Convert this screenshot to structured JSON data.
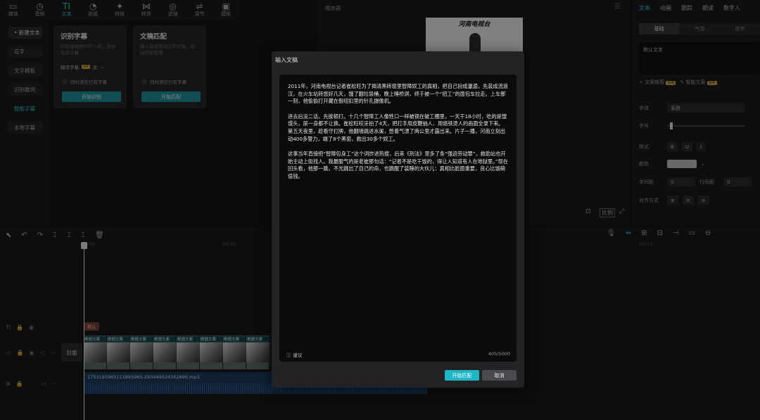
{
  "top_tabs": [
    {
      "label": "媒体",
      "icon": "media-icon",
      "glyph": "▭"
    },
    {
      "label": "音频",
      "icon": "audio-icon",
      "glyph": "◷"
    },
    {
      "label": "文本",
      "icon": "text-icon",
      "glyph": "TI"
    },
    {
      "label": "贴纸",
      "icon": "sticker-icon",
      "glyph": "◔"
    },
    {
      "label": "特效",
      "icon": "effects-icon",
      "glyph": "✦"
    },
    {
      "label": "转场",
      "icon": "transition-icon",
      "glyph": "⋈"
    },
    {
      "label": "滤镜",
      "icon": "filter-icon",
      "glyph": "◎"
    },
    {
      "label": "调节",
      "icon": "adjust-icon",
      "glyph": "⇌"
    },
    {
      "label": "模板",
      "icon": "template-icon",
      "glyph": "▣"
    }
  ],
  "left_list": [
    "• 新建文本",
    "花字",
    "文字模板",
    "识别歌词",
    "智能字幕",
    "本地字幕"
  ],
  "card_recognize": {
    "title": "识别字幕",
    "desc": "识别音视频中的人声，自动生成字幕",
    "translate_label": "翻译字幕",
    "translate_value": "无",
    "vip": "VIP",
    "checkbox": "同时清空已有字幕",
    "button": "开始识别"
  },
  "card_match": {
    "title": "文稿匹配",
    "desc": "输入音视频对应的文稿，自动匹配画面",
    "checkbox": "同时清空已有字幕",
    "button": "开始匹配"
  },
  "player": {
    "title": "播放器",
    "video_text": "河南电视台",
    "ratio": "比例"
  },
  "right_panel": {
    "tabs": [
      "文本",
      "动画",
      "跟踪",
      "朗读",
      "数字人"
    ],
    "sub_tabs": [
      "基础",
      "气泡",
      "花字"
    ],
    "default_text": "默认文本",
    "recommend": "文案推荐",
    "smart_copy": "智能文案",
    "free_badge": "限免",
    "font_label": "字体",
    "font_value": "系统",
    "size_label": "字号",
    "style_label": "样式",
    "color_label": "颜色",
    "char_spacing_label": "字间距",
    "char_spacing_value": "0",
    "line_spacing_label": "行间距",
    "line_spacing_value": "0",
    "align_label": "对齐方式"
  },
  "timeline": {
    "ruler_ticks": [
      "00:00",
      "|00:05",
      "|00:10"
    ],
    "clip_tag": "默认",
    "cover_label": "封面",
    "clip_label": "根据文案",
    "audio_file": "1753195965111895965-293449524342899.mp3"
  },
  "modal": {
    "title": "输入文稿",
    "paragraphs": [
      "2011年，河南电视台记者崔松旺为了揭清黑砖窑里智障奴工的真相，把自己扮成邋遢，先装成流浪汉，在火车站转悠好几天，饿了翻垃圾桶，晚上睡桥洞，终于被一个“招工”的面包车拉走。上车那一刻，他偷偷打开藏在假纽扣里的针孔摄像机。",
      "进去后没二话，先挨顿打。十几个智障工人像牲口一样被锁在破工棚里，一天干18小时，吃的是馊馒头，尿一身都不让换。崔松旺咬牙拍了4天，把打手用皮鞭抽人、用烙铁烫人的画面全录下来。第五天夜里，趁看守打牌，他翻墙跳进水渠，憋着气漂了两公里才露出来。片子一播，河南立刻出动400多警力，端了8个黑窑，救出30多个奴工。",
      "这事当年直接把“智障包身工”这个词炸进热搜，后来《刑法》里多了条“强迫劳动罪”，救助站也开始主动上街找人。我最服气的是老崔那句话：“记者不是吃干饭的，得让人知道有人在地狱里。”现在回头看，他那一跳，不光跳出了自己的命，也跳醒了装睡的大伙儿：真相比脸面重要，良心比饭碗值钱。"
    ],
    "suggest_label": "建议",
    "char_count": "405/5000",
    "start_button": "开始匹配",
    "cancel_button": "取消"
  }
}
